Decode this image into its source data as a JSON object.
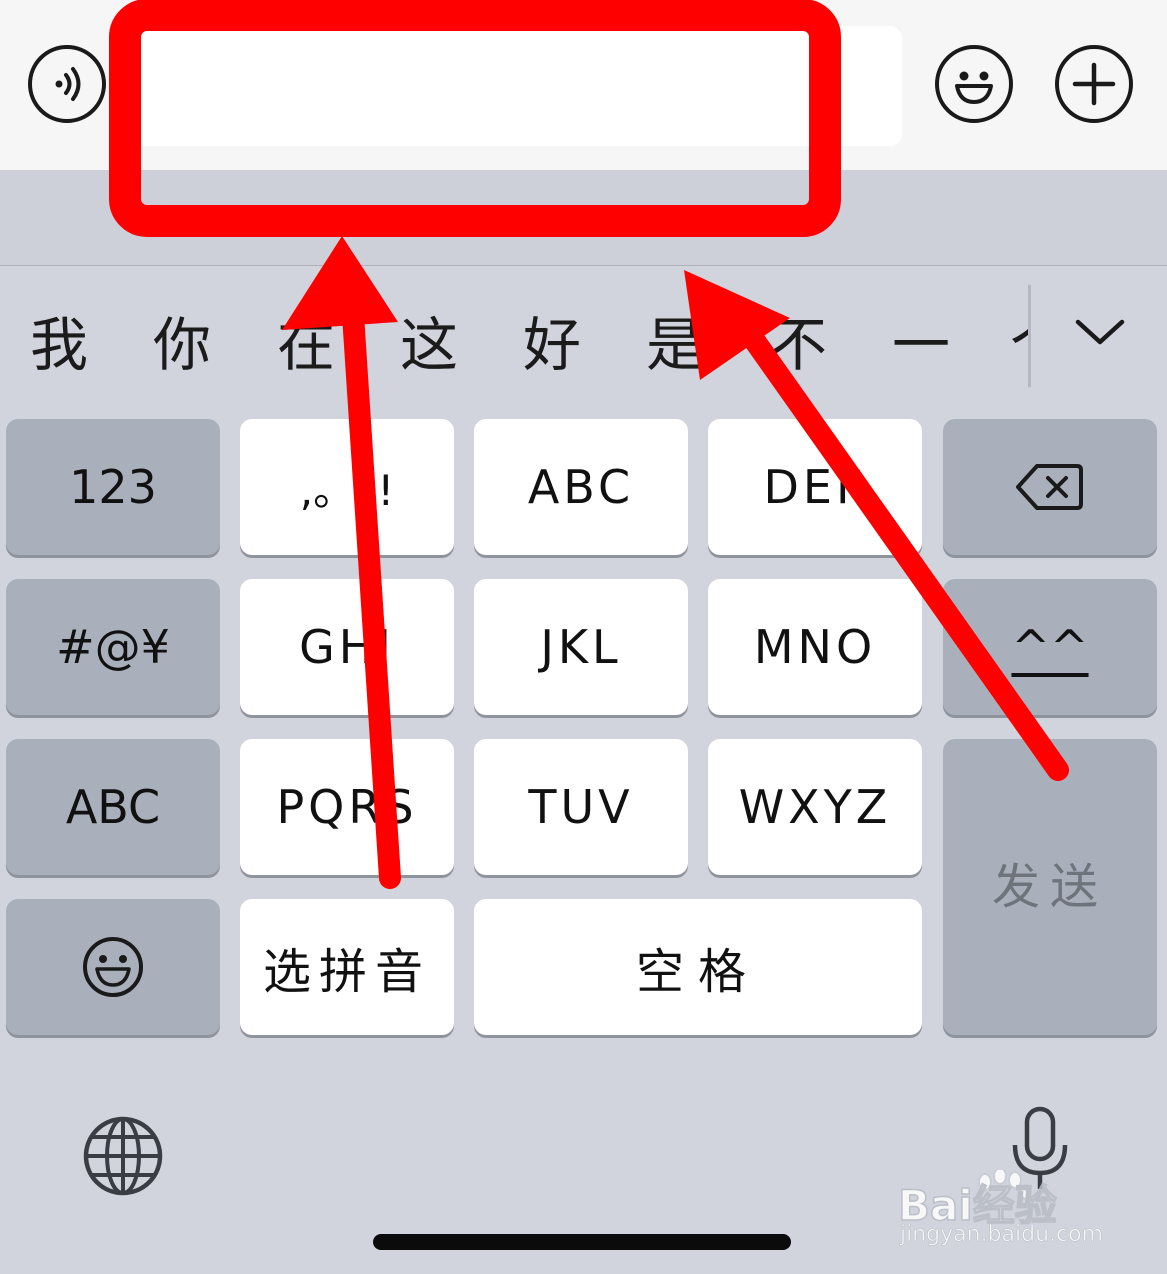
{
  "chat_bar": {
    "voice_icon": "voice-icon",
    "emoji_icon": "emoji-icon",
    "add_icon": "plus-icon",
    "input_value": ""
  },
  "candidates": {
    "items": [
      "我",
      "你",
      "在",
      "这",
      "好",
      "是",
      "不",
      "一",
      "个"
    ],
    "expand_icon": "chevron-down-icon"
  },
  "keyboard": {
    "row1": [
      "123",
      ",。?!",
      "ABC",
      "DEF"
    ],
    "row2": [
      "#@¥",
      "GHI",
      "JKL",
      "MNO",
      "^^"
    ],
    "row3": [
      "ABC",
      "PQRS",
      "TUV",
      "WXYZ"
    ],
    "row4": {
      "pinyin": "选拼音",
      "space": "空格"
    },
    "send": "发送",
    "backspace_icon": "backspace-icon",
    "emoji_icon": "emoji-icon",
    "globe_icon": "globe-icon",
    "mic_icon": "microphone-icon"
  },
  "watermark": {
    "brand": "Bai经验",
    "url": "jingyan.baidu.com"
  },
  "colors": {
    "annotation": "#ff0000",
    "keyboard_bg": "#d1d4dd",
    "key_light": "#ffffff",
    "key_dark": "#aab0bb"
  }
}
